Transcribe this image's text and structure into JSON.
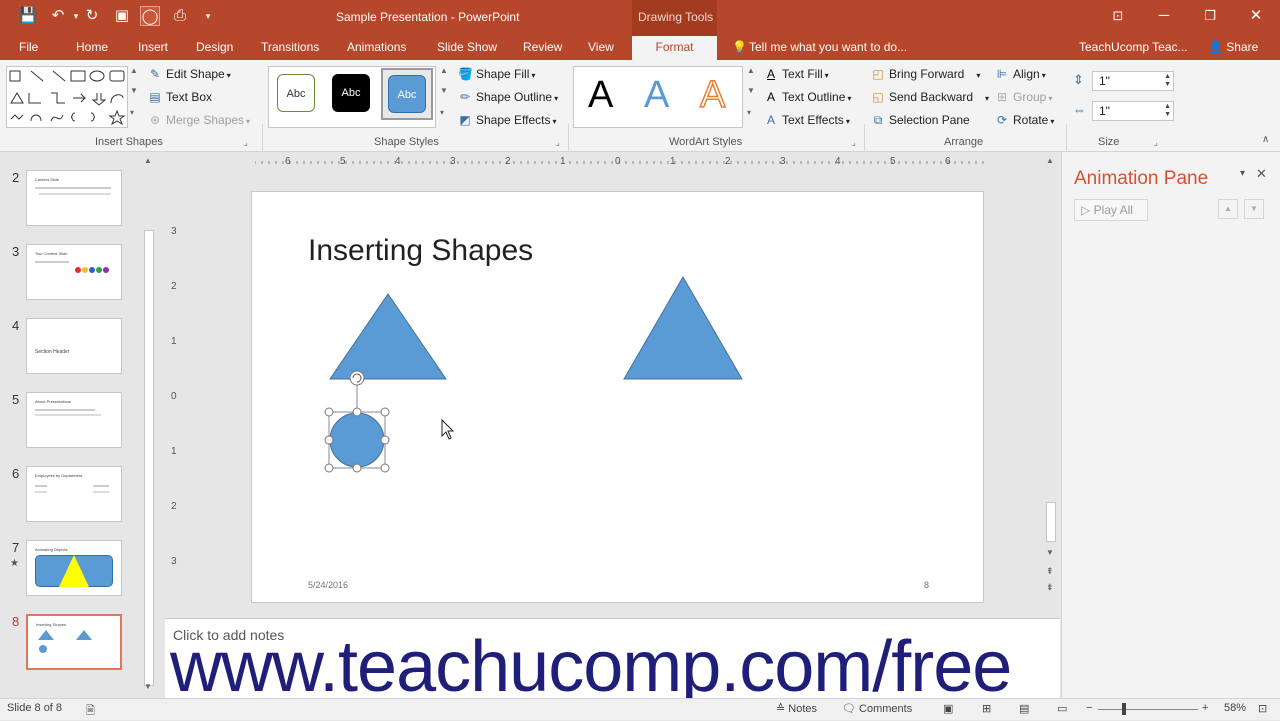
{
  "titlebar": {
    "title": "Sample Presentation - PowerPoint",
    "contextual_label": "Drawing Tools",
    "qat_icons": [
      "save-icon",
      "undo-icon",
      "redo-icon",
      "start-from-beginning-icon",
      "oval-shape-icon",
      "touch-mode-icon",
      "customize-qat-icon"
    ],
    "window_controls": [
      "ribbon-display-options-icon",
      "minimize-icon",
      "restore-icon",
      "close-icon"
    ]
  },
  "tabs": {
    "file": "File",
    "home": "Home",
    "insert": "Insert",
    "design": "Design",
    "transitions": "Transitions",
    "animations": "Animations",
    "slide_show": "Slide Show",
    "review": "Review",
    "view": "View",
    "format": "Format",
    "tell_me": "Tell me what you want to do...",
    "account": "TeachUcomp Teac...",
    "share": "Share"
  },
  "ribbon": {
    "insert_shapes": {
      "label": "Insert Shapes",
      "edit_shape": "Edit Shape",
      "text_box": "Text Box",
      "merge_shapes": "Merge Shapes"
    },
    "shape_styles": {
      "label": "Shape Styles",
      "swatch_text": "Abc",
      "shape_fill": "Shape Fill",
      "shape_outline": "Shape Outline",
      "shape_effects": "Shape Effects"
    },
    "wordart_styles": {
      "label": "WordArt Styles",
      "sample": "A",
      "text_fill": "Text Fill",
      "text_outline": "Text Outline",
      "text_effects": "Text Effects"
    },
    "arrange": {
      "label": "Arrange",
      "bring_forward": "Bring Forward",
      "send_backward": "Send Backward",
      "selection_pane": "Selection Pane",
      "align": "Align",
      "group": "Group",
      "rotate": "Rotate"
    },
    "size": {
      "label": "Size",
      "height": "1\"",
      "width": "1\""
    }
  },
  "thumbnails": [
    {
      "num": "2",
      "title": "Content Slide",
      "star": ""
    },
    {
      "num": "3",
      "title": "Two Content Slide",
      "star": ""
    },
    {
      "num": "4",
      "title": "Section Header",
      "star": ""
    },
    {
      "num": "5",
      "title": "About Presentations",
      "star": ""
    },
    {
      "num": "6",
      "title": "Employees by Department",
      "star": ""
    },
    {
      "num": "7",
      "title": "Animating Objects",
      "star": "★"
    },
    {
      "num": "8",
      "title": "Inserting Shapes",
      "star": ""
    }
  ],
  "ruler": {
    "h_ticks": [
      "6",
      "5",
      "4",
      "3",
      "2",
      "1",
      "0",
      "1",
      "2",
      "3",
      "4",
      "5",
      "6"
    ],
    "v_ticks": [
      "3",
      "2",
      "1",
      "0",
      "1",
      "2",
      "3"
    ]
  },
  "slide": {
    "title": "Inserting Shapes",
    "date": "5/24/2016",
    "page_number": "8",
    "shape_color": "#5b9bd5"
  },
  "notes": {
    "placeholder": "Click to add notes",
    "watermark": "www.teachucomp.com/free"
  },
  "animation_pane": {
    "title": "Animation Pane",
    "play_all": "Play All"
  },
  "status": {
    "slide_count": "Slide 8 of 8",
    "notes": "Notes",
    "comments": "Comments",
    "zoom": "58%"
  },
  "colors": {
    "accent": "#b7472a",
    "shape_blue": "#5b9bd5",
    "watermark": "#1f1f7a"
  }
}
